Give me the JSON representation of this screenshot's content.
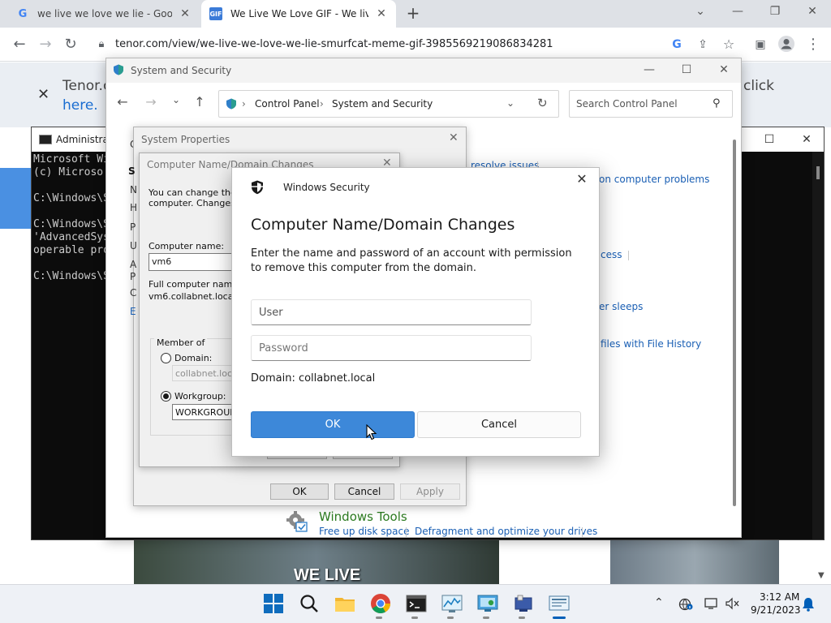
{
  "browser": {
    "tabs": [
      {
        "title": "we live we love we lie - Google S"
      },
      {
        "title": "We Live We Love GIF - We live W"
      }
    ],
    "new_tab_symbol": "+",
    "url": "tenor.com/view/we-live-we-love-we-lie-smurfcat-meme-gif-3985569219086834281"
  },
  "page": {
    "banner_line1": "Tenor.c",
    "banner_line2": "here.",
    "banner_click": "click",
    "gif_caption": "WE LIVE"
  },
  "cmd": {
    "title": "Administrat",
    "lines": [
      "Microsoft Wi",
      "(c) Microso",
      "",
      "C:\\Windows\\S",
      "",
      "C:\\Windows\\S",
      "'AdvancedSys",
      "operable pro",
      "",
      "C:\\Windows\\S"
    ]
  },
  "control_panel": {
    "title": "System and Security",
    "breadcrumb": [
      "Control Panel",
      "System and Security"
    ],
    "search_placeholder": "Search Control Panel",
    "links": {
      "resolve_issues": "resolve issues",
      "common_problems": "on computer problems",
      "access": "cess",
      "sleeps": "er sleeps",
      "file_history": "files with File History",
      "free_space": "Free up disk space",
      "defragment": "Defragment and optimize your drives"
    },
    "windows_tools_title": "Windows Tools",
    "left_fragments": [
      "C",
      "S",
      "N",
      "H",
      "P",
      "U",
      "A",
      "P",
      "C",
      "E"
    ],
    "mote_fragment": "mote"
  },
  "system_properties": {
    "title": "System Properties",
    "buttons": {
      "ok": "OK",
      "cancel": "Cancel",
      "apply": "Apply"
    }
  },
  "name_changes": {
    "title": "Computer Name/Domain Changes",
    "intro_line1": "You can change the n",
    "intro_line2": "computer. Changes m",
    "computer_name_label": "Computer name:",
    "computer_name_value": "vm6",
    "full_name_label": "Full computer name:",
    "full_name_value": "vm6.collabnet.local",
    "member_of_label": "Member of",
    "domain_label": "Domain:",
    "domain_value": "collabnet.local",
    "workgroup_label": "Workgroup:",
    "workgroup_value": "WORKGROUP"
  },
  "windows_security": {
    "app_name": "Windows Security",
    "heading": "Computer Name/Domain Changes",
    "description": "Enter the name and password of an account with permission to remove this computer from the domain.",
    "user_value": "User",
    "password_placeholder": "Password",
    "domain_text": "Domain: collabnet.local",
    "ok_label": "OK",
    "cancel_label": "Cancel"
  },
  "taskbar": {
    "time": "3:12 AM",
    "date": "9/21/2023"
  },
  "colors": {
    "ok_button": "#3d88d9",
    "link": "#1a5fb4",
    "windows_tools": "#2b7a1f",
    "taskbar_accent": "#005fb8"
  }
}
